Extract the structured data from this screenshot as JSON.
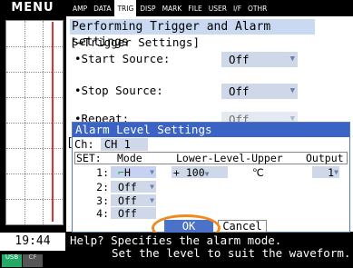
{
  "menu_label": "MENU",
  "tabs": [
    {
      "label": "AMP",
      "active": false
    },
    {
      "label": "DATA",
      "active": false
    },
    {
      "label": "TRIG",
      "active": true
    },
    {
      "label": "DISP",
      "active": false
    },
    {
      "label": "MARK",
      "active": false
    },
    {
      "label": "FILE",
      "active": false
    },
    {
      "label": "USER",
      "active": false
    },
    {
      "label": "I/F",
      "active": false
    },
    {
      "label": "OTHR",
      "active": false
    }
  ],
  "page_title": "Performing Trigger and Alarm settings",
  "section_title": "[⇝Trigger Settings]",
  "settings": {
    "start_source": {
      "label": "•Start Source:",
      "value": "Off"
    },
    "stop_source": {
      "label": "•Stop Source:",
      "value": "Off"
    },
    "repeat": {
      "label": "•Repeat:",
      "value": "Off"
    },
    "bracket": "["
  },
  "clock": "19:44",
  "badges": {
    "usb": "USB",
    "cf": "CF"
  },
  "dialog": {
    "title": "Alarm Level Settings",
    "ch_label": "Ch:",
    "ch_value": "CH 1",
    "headers": {
      "set": "SET:",
      "mode": "Mode",
      "level": "Lower-Level-Upper",
      "output": "Output"
    },
    "rows": [
      {
        "num": "1:",
        "mode": "H",
        "level": "+ 100",
        "unit": "℃",
        "output": "1"
      },
      {
        "num": "2:",
        "mode": "Off"
      },
      {
        "num": "3:",
        "mode": "Off"
      },
      {
        "num": "4:",
        "mode": "Off"
      }
    ],
    "ok_label": "OK",
    "cancel_label": "Cancel"
  },
  "help": {
    "line1": "Help? Specifies the alarm mode.",
    "line2": "Set the level to suit the waveform."
  },
  "colors": {
    "title_bar": "#3b62c5",
    "highlight_ring": "#f08a1e",
    "field_bg": "#cfd8e8"
  }
}
